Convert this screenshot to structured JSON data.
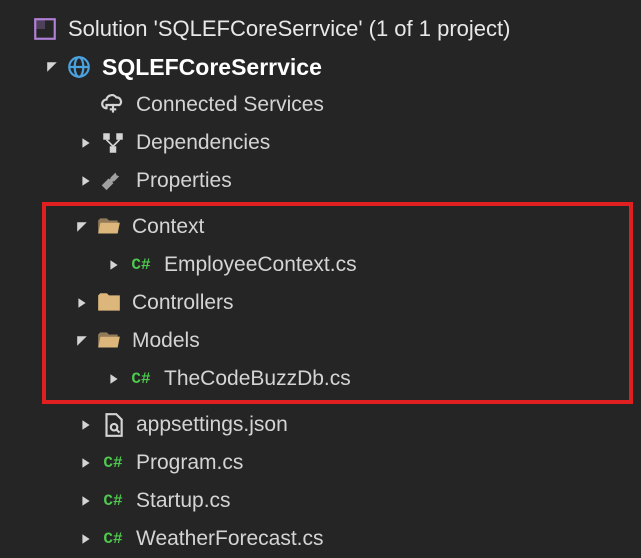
{
  "solution": {
    "label": "Solution 'SQLEFCoreSerrvice' (1 of 1 project)"
  },
  "project": {
    "label": "SQLEFCoreSerrvice"
  },
  "nodes": {
    "connected_services": "Connected Services",
    "dependencies": "Dependencies",
    "properties": "Properties",
    "context": "Context",
    "employee_context": "EmployeeContext.cs",
    "controllers": "Controllers",
    "models": "Models",
    "codebuzz": "TheCodeBuzzDb.cs",
    "appsettings": "appsettings.json",
    "program": "Program.cs",
    "startup": "Startup.cs",
    "weather": "WeatherForecast.cs"
  },
  "csharp_badge": "C#"
}
